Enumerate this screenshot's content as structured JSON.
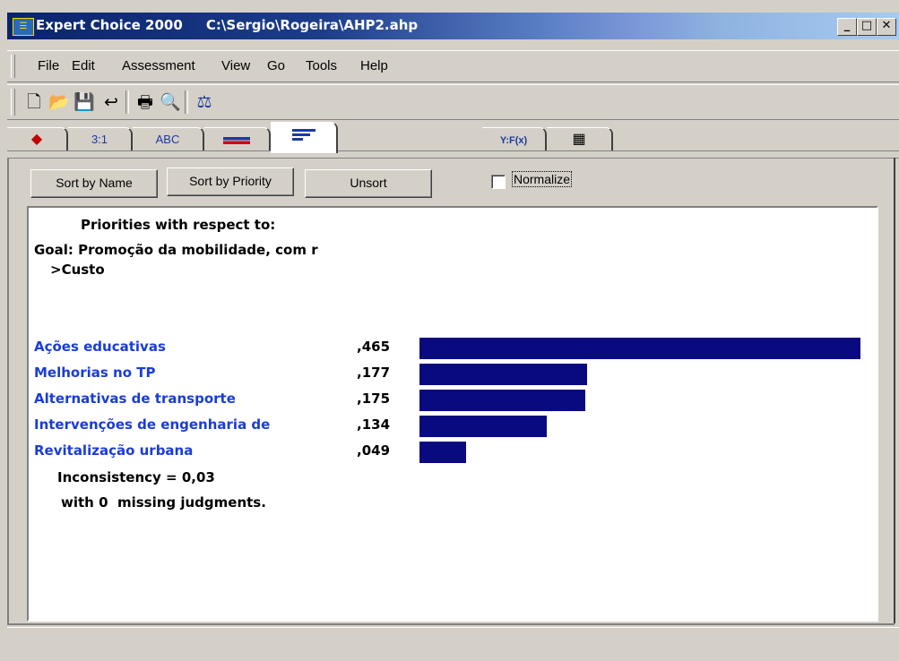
{
  "window": {
    "title": "Expert Choice 2000     C:\\Sergio\\Rogeira\\AHP2.ahp",
    "minimize": "_",
    "maximize": "□",
    "close": "✕"
  },
  "menu": {
    "items": [
      "File",
      "Edit",
      "Assessment",
      "View",
      "Go",
      "Tools",
      "Help"
    ]
  },
  "toolbar": {
    "icons": [
      "new-file-icon",
      "open-folder-icon",
      "save-icon",
      "undo-icon",
      "print-icon",
      "print-preview-icon",
      "synthesize-icon"
    ]
  },
  "tabs": [
    {
      "label": "",
      "icon": "graphic-mode-icon"
    },
    {
      "label": "3:1",
      "icon": "numeric-mode-icon"
    },
    {
      "label": "ABC",
      "icon": "verbal-mode-icon"
    },
    {
      "label": "",
      "icon": "graphic-bar-mode-icon"
    },
    {
      "label": "",
      "icon": "priorities-mode-icon"
    },
    {
      "label": "Y:F(x)",
      "icon": "formula-icon"
    },
    {
      "label": "",
      "icon": "grid-icon"
    }
  ],
  "actions": {
    "sort_name": "Sort by Name",
    "sort_priority": "Sort by Priority",
    "unsort": "Unsort",
    "normalize": "Normalize",
    "normalize_checked": false
  },
  "content": {
    "heading": "Priorities with respect to:",
    "goal": "Goal: Promoção da mobilidade, com r",
    "node": ">Custo",
    "alternatives": [
      {
        "name": "Ações educativas",
        "value": ",465",
        "priority": 0.465
      },
      {
        "name": "Melhorias no TP",
        "value": ",177",
        "priority": 0.177
      },
      {
        "name": "Alternativas de transporte",
        "value": ",175",
        "priority": 0.175
      },
      {
        "name": "Intervenções de engenharia de",
        "value": ",134",
        "priority": 0.134
      },
      {
        "name": "Revitalização urbana",
        "value": ",049",
        "priority": 0.049
      }
    ],
    "inconsistency": "Inconsistency = 0,03",
    "missing": "with 0  missing judgments."
  },
  "colors": {
    "bar": "#0a0a80",
    "alt_text": "#1a3cd8"
  }
}
